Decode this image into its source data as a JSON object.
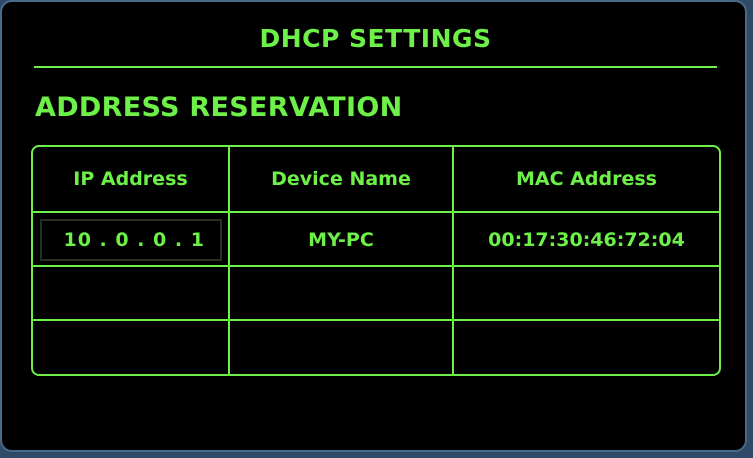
{
  "panel": {
    "title": "DHCP SETTINGS",
    "section_heading": "ADDRESS RESERVATION"
  },
  "table": {
    "columns": [
      "IP Address",
      "Device Name",
      "MAC Address"
    ],
    "rows": [
      {
        "ip": "10 . 0 . 0 . 1",
        "device": "MY-PC",
        "mac": "00:17:30:46:72:04"
      },
      {
        "ip": "",
        "device": "",
        "mac": ""
      },
      {
        "ip": "",
        "device": "",
        "mac": ""
      }
    ]
  },
  "colors": {
    "accent": "#6df048",
    "background": "#000000",
    "frame": "#2f4a66"
  }
}
